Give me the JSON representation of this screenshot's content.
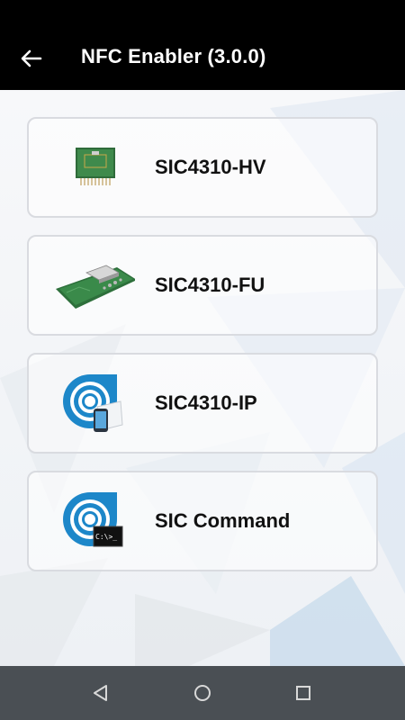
{
  "app": {
    "title": "NFC Enabler (3.0.0)"
  },
  "cards": [
    {
      "label": "SIC4310-HV",
      "icon": "board-hv-icon"
    },
    {
      "label": "SIC4310-FU",
      "icon": "board-fu-icon"
    },
    {
      "label": "SIC4310-IP",
      "icon": "nfc-phone-icon"
    },
    {
      "label": "SIC Command",
      "icon": "nfc-terminal-icon"
    }
  ],
  "terminal_text": "C:\\>_",
  "navbar": {
    "items": [
      "back-icon",
      "home-icon",
      "recents-icon"
    ]
  },
  "colors": {
    "appbar": "#000000",
    "navbar": "#4a4f54",
    "accent_blue": "#1d87c9",
    "card_border": "#d9dbe0"
  }
}
